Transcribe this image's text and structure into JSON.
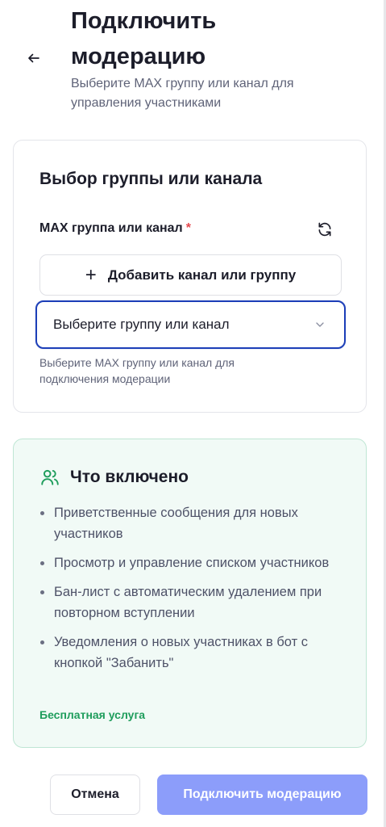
{
  "header": {
    "title_line1": "Подключить",
    "title_line2": "модерацию",
    "subtitle": "Выберите MAX группу или канал для управления участниками"
  },
  "selection_card": {
    "title": "Выбор группы или канала",
    "field_label": "MAX группа или канал",
    "required_mark": "*",
    "add_button_label": "Добавить канал или группу",
    "select_placeholder": "Выберите группу или канал",
    "helper_text": "Выберите MAX группу или канал для подключения модерации"
  },
  "included_card": {
    "title": "Что включено",
    "features": [
      "Приветственные сообщения для новых участников",
      "Просмотр и управление списком участников",
      "Бан-лист с автоматическим удалением при повторном вступлении",
      "Уведомления о новых участниках в бот с кнопкой \"Забанить\""
    ],
    "free_label": "Бесплатная услуга"
  },
  "footer": {
    "cancel_label": "Отмена",
    "submit_label": "Подключить модерацию"
  },
  "icons": {
    "back": "arrow-left-icon",
    "refresh": "refresh-icon",
    "add": "plus-icon",
    "dropdown": "chevron-down-icon",
    "included": "users-icon"
  },
  "colors": {
    "accent": "#1d3fb8",
    "submit_bg": "#8c9dfa",
    "success": "#1f9d5c",
    "required": "#e5484d",
    "info_bg": "#f1faf6",
    "info_border": "#bfe6d4"
  }
}
